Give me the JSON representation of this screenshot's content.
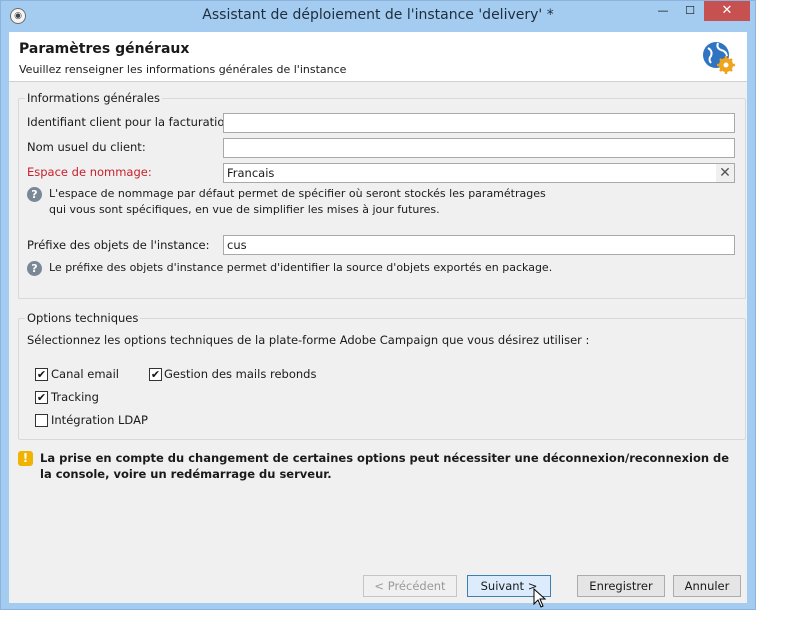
{
  "window": {
    "title": "Assistant de déploiement de l'instance 'delivery' *",
    "minimize_glyph": "—",
    "maximize_glyph": "☐",
    "close_glyph": "✕"
  },
  "header": {
    "title": "Paramètres généraux",
    "subtitle": "Veuillez renseigner les informations générales de l'instance",
    "icon": "globe-gear-icon"
  },
  "general": {
    "legend": "Informations générales",
    "billing_id": {
      "label": "Identifiant client pour la facturation:",
      "value": ""
    },
    "customer_name": {
      "label": "Nom usuel du client:",
      "value": ""
    },
    "namespace": {
      "label": "Espace de nommage:",
      "value": "Francais",
      "help": [
        "L'espace de nommage par défaut permet de spécifier où seront stockés les paramétrages",
        "qui vous sont spécifiques, en vue de simplifier les mises à jour futures."
      ]
    },
    "prefix": {
      "label": "Préfixe des objets de l'instance:",
      "value": "cus",
      "help": "Le préfixe des objets d'instance permet d'identifier la source d'objets exportés en package."
    }
  },
  "technical": {
    "legend": "Options techniques",
    "intro": "Sélectionnez les options techniques de la plate-forme Adobe Campaign que vous désirez utiliser :",
    "options": [
      {
        "label": "Canal email",
        "checked": true,
        "mark": "✔"
      },
      {
        "label": "Gestion des mails rebonds",
        "checked": true,
        "mark": "✔"
      },
      {
        "label": "Tracking",
        "checked": true,
        "mark": "✔"
      },
      {
        "label": "Intégration LDAP",
        "checked": false,
        "mark": ""
      }
    ]
  },
  "warning": {
    "text": "La prise en compte du changement de certaines options peut nécessiter une déconnexion/reconnexion de la console, voire un redémarrage du serveur."
  },
  "buttons": {
    "previous": "< Précédent",
    "next": "Suivant >",
    "save": "Enregistrer",
    "cancel": "Annuler"
  },
  "colors": {
    "accent_label": "#c8202d",
    "title_bar": "#a3ccf0",
    "close_button": "#c75050",
    "warning": "#f0b400"
  }
}
